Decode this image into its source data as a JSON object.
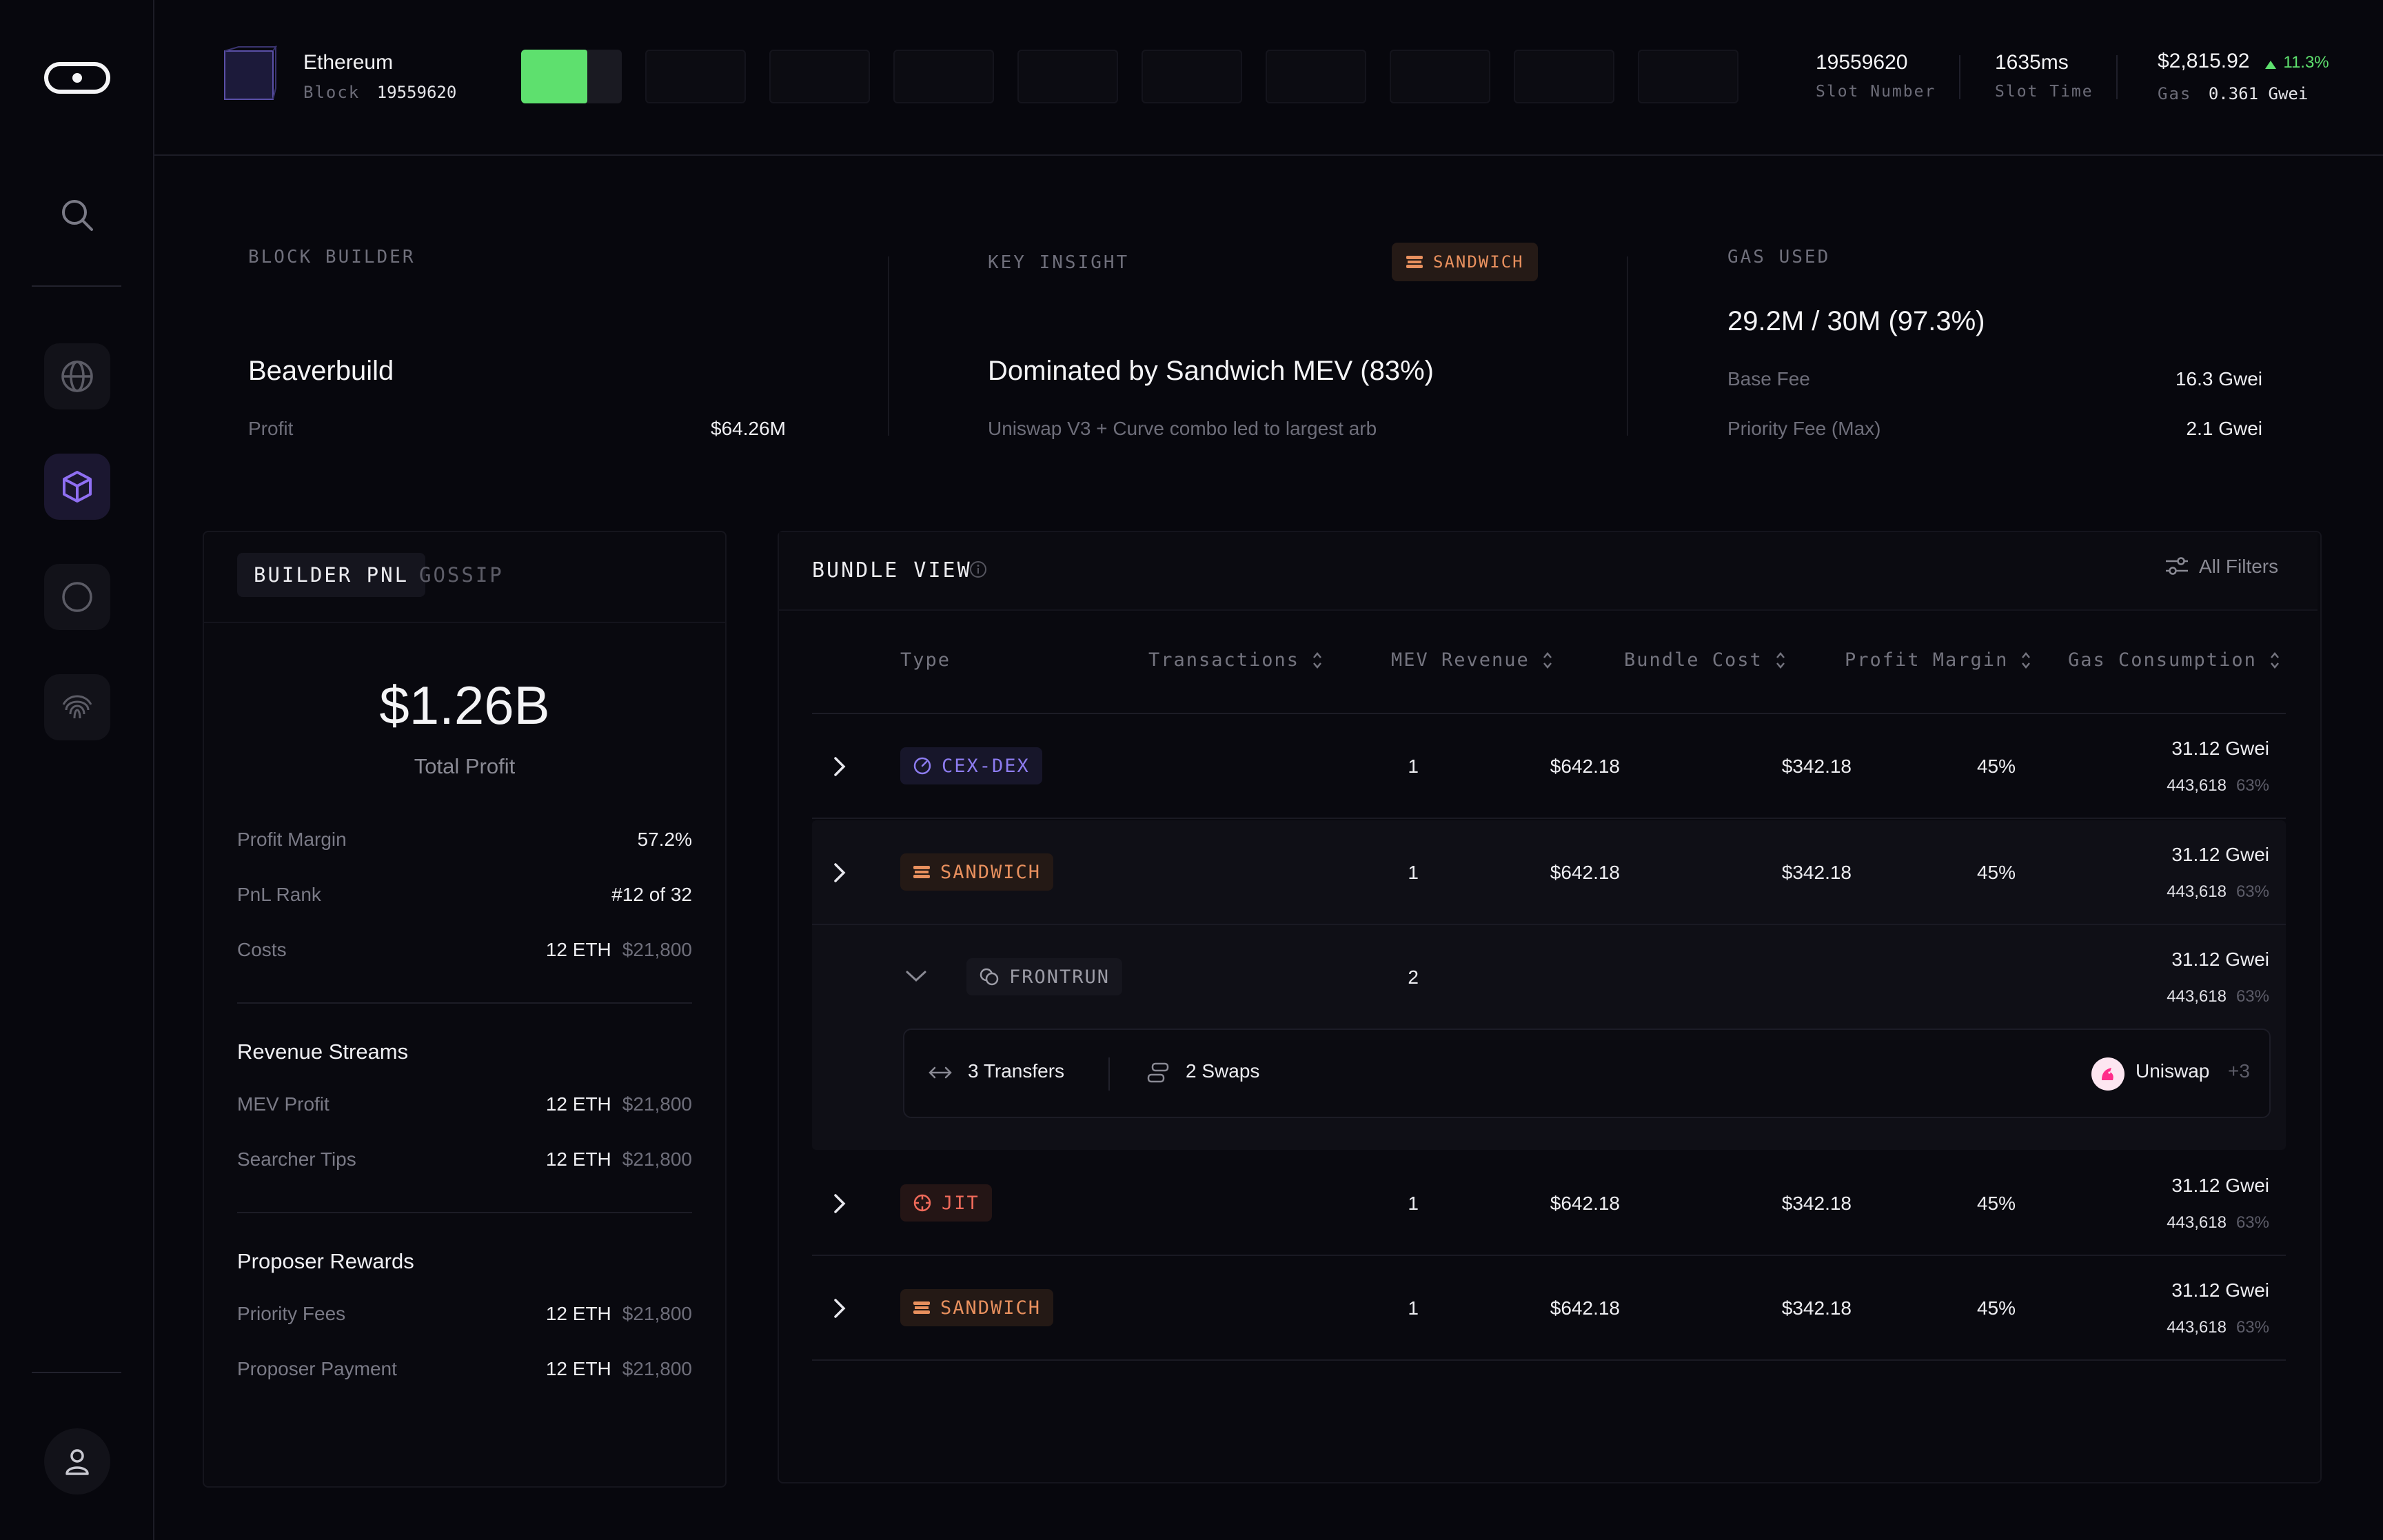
{
  "header": {
    "chain_name": "Ethereum",
    "block_label": "Block",
    "block_number": "19559620",
    "slot_number": "19559620",
    "slot_number_label": "Slot Number",
    "slot_time": "1635ms",
    "slot_time_label": "Slot Time",
    "eth_price": "$2,815.92",
    "price_change": "11.3%",
    "gas_label": "Gas",
    "gas_value": "0.361 Gwei"
  },
  "summary": {
    "builder": {
      "label": "BLOCK BUILDER",
      "name": "Beaverbuild",
      "profit_label": "Profit",
      "profit_value": "$64.26M"
    },
    "insight": {
      "label": "KEY INSIGHT",
      "badge": "SANDWICH",
      "headline": "Dominated by Sandwich MEV (83%)",
      "detail": "Uniswap V3 + Curve combo led to largest arb"
    },
    "gas": {
      "label": "GAS USED",
      "used": "29.2M / 30M (97.3%)",
      "base_fee_label": "Base Fee",
      "base_fee_value": "16.3 Gwei",
      "priority_fee_label": "Priority Fee (Max)",
      "priority_fee_value": "2.1 Gwei"
    }
  },
  "pnl_panel": {
    "tabs": [
      "BUILDER PNL",
      "GOSSIP"
    ],
    "total_profit": "$1.26B",
    "total_profit_label": "Total Profit",
    "profit_margin_label": "Profit Margin",
    "profit_margin_value": "57.2%",
    "pnl_rank_label": "PnL Rank",
    "pnl_rank_value": "#12 of 32",
    "costs_label": "Costs",
    "costs_eth": "12 ETH",
    "costs_usd": "$21,800",
    "revenue_title": "Revenue Streams",
    "mev_profit_label": "MEV Profit",
    "mev_profit_eth": "12 ETH",
    "mev_profit_usd": "$21,800",
    "searcher_tips_label": "Searcher Tips",
    "searcher_tips_eth": "12 ETH",
    "searcher_tips_usd": "$21,800",
    "proposer_title": "Proposer Rewards",
    "priority_fees_label": "Priority Fees",
    "priority_fees_eth": "12 ETH",
    "priority_fees_usd": "$21,800",
    "proposer_payment_label": "Proposer Payment",
    "proposer_payment_eth": "12 ETH",
    "proposer_payment_usd": "$21,800"
  },
  "bundle_view": {
    "title": "BUNDLE VIEW",
    "filters_label": "All Filters",
    "columns": {
      "type": "Type",
      "transactions": "Transactions",
      "mev_revenue": "MEV Revenue",
      "bundle_cost": "Bundle Cost",
      "profit_margin": "Profit Margin",
      "gas_consumption": "Gas Consumption"
    },
    "rows": [
      {
        "type": "CEX-DEX",
        "transactions": "1",
        "mev_revenue": "$642.18",
        "bundle_cost": "$342.18",
        "profit_margin": "45%",
        "gas_gwei": "31.12 Gwei",
        "gas_units": "443,618",
        "gas_pct": "63%"
      },
      {
        "type": "SANDWICH",
        "transactions": "1",
        "mev_revenue": "$642.18",
        "bundle_cost": "$342.18",
        "profit_margin": "45%",
        "gas_gwei": "31.12 Gwei",
        "gas_units": "443,618",
        "gas_pct": "63%"
      },
      {
        "type": "JIT",
        "transactions": "1",
        "mev_revenue": "$642.18",
        "bundle_cost": "$342.18",
        "profit_margin": "45%",
        "gas_gwei": "31.12 Gwei",
        "gas_units": "443,618",
        "gas_pct": "63%"
      },
      {
        "type": "SANDWICH",
        "transactions": "1",
        "mev_revenue": "$642.18",
        "bundle_cost": "$342.18",
        "profit_margin": "45%",
        "gas_gwei": "31.12 Gwei",
        "gas_units": "443,618",
        "gas_pct": "63%"
      }
    ],
    "expanded": {
      "type": "FRONTRUN",
      "transactions": "2",
      "gas_gwei": "31.12 Gwei",
      "gas_units": "443,618",
      "gas_pct": "63%",
      "transfers": "3 Transfers",
      "swaps": "2 Swaps",
      "protocol": "Uniswap",
      "protocol_more": "+3"
    }
  },
  "colors": {
    "accent_green": "#5ee06e",
    "sandwich_orange": "#e8905e",
    "cex_purple": "#8d7cf0",
    "jit_red": "#ef6a5a",
    "active_nav": "#8f6ff2"
  }
}
